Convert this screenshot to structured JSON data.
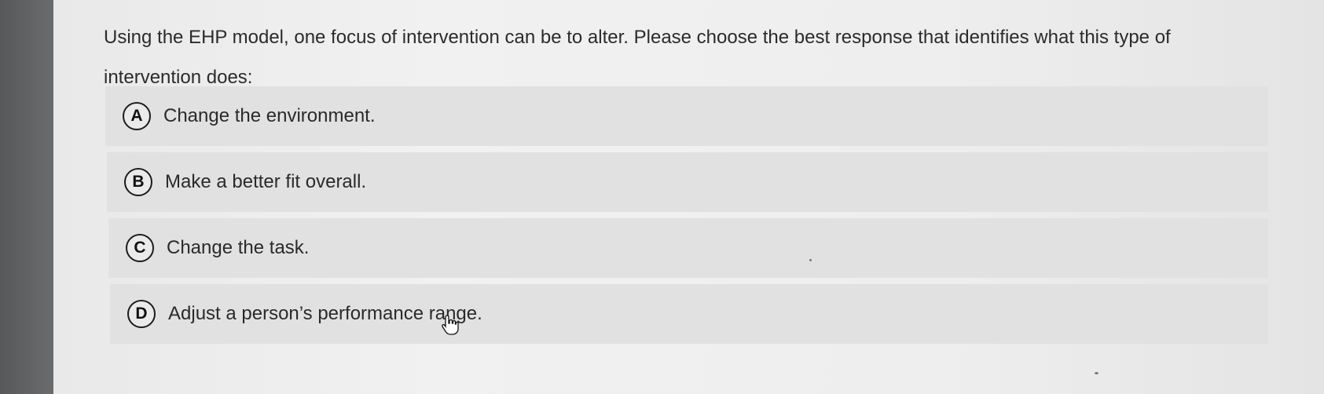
{
  "question": {
    "text": "Using the EHP model, one focus of intervention can be to alter. Please choose the best response that identifies what this type of intervention does:"
  },
  "options": [
    {
      "letter": "A",
      "label": "Change the environment."
    },
    {
      "letter": "B",
      "label": "Make a better fit overall."
    },
    {
      "letter": "C",
      "label": "Change the task."
    },
    {
      "letter": "D",
      "label": "Adjust a person’s performance range."
    }
  ],
  "cursor": {
    "icon": "hand-pointer-icon"
  }
}
